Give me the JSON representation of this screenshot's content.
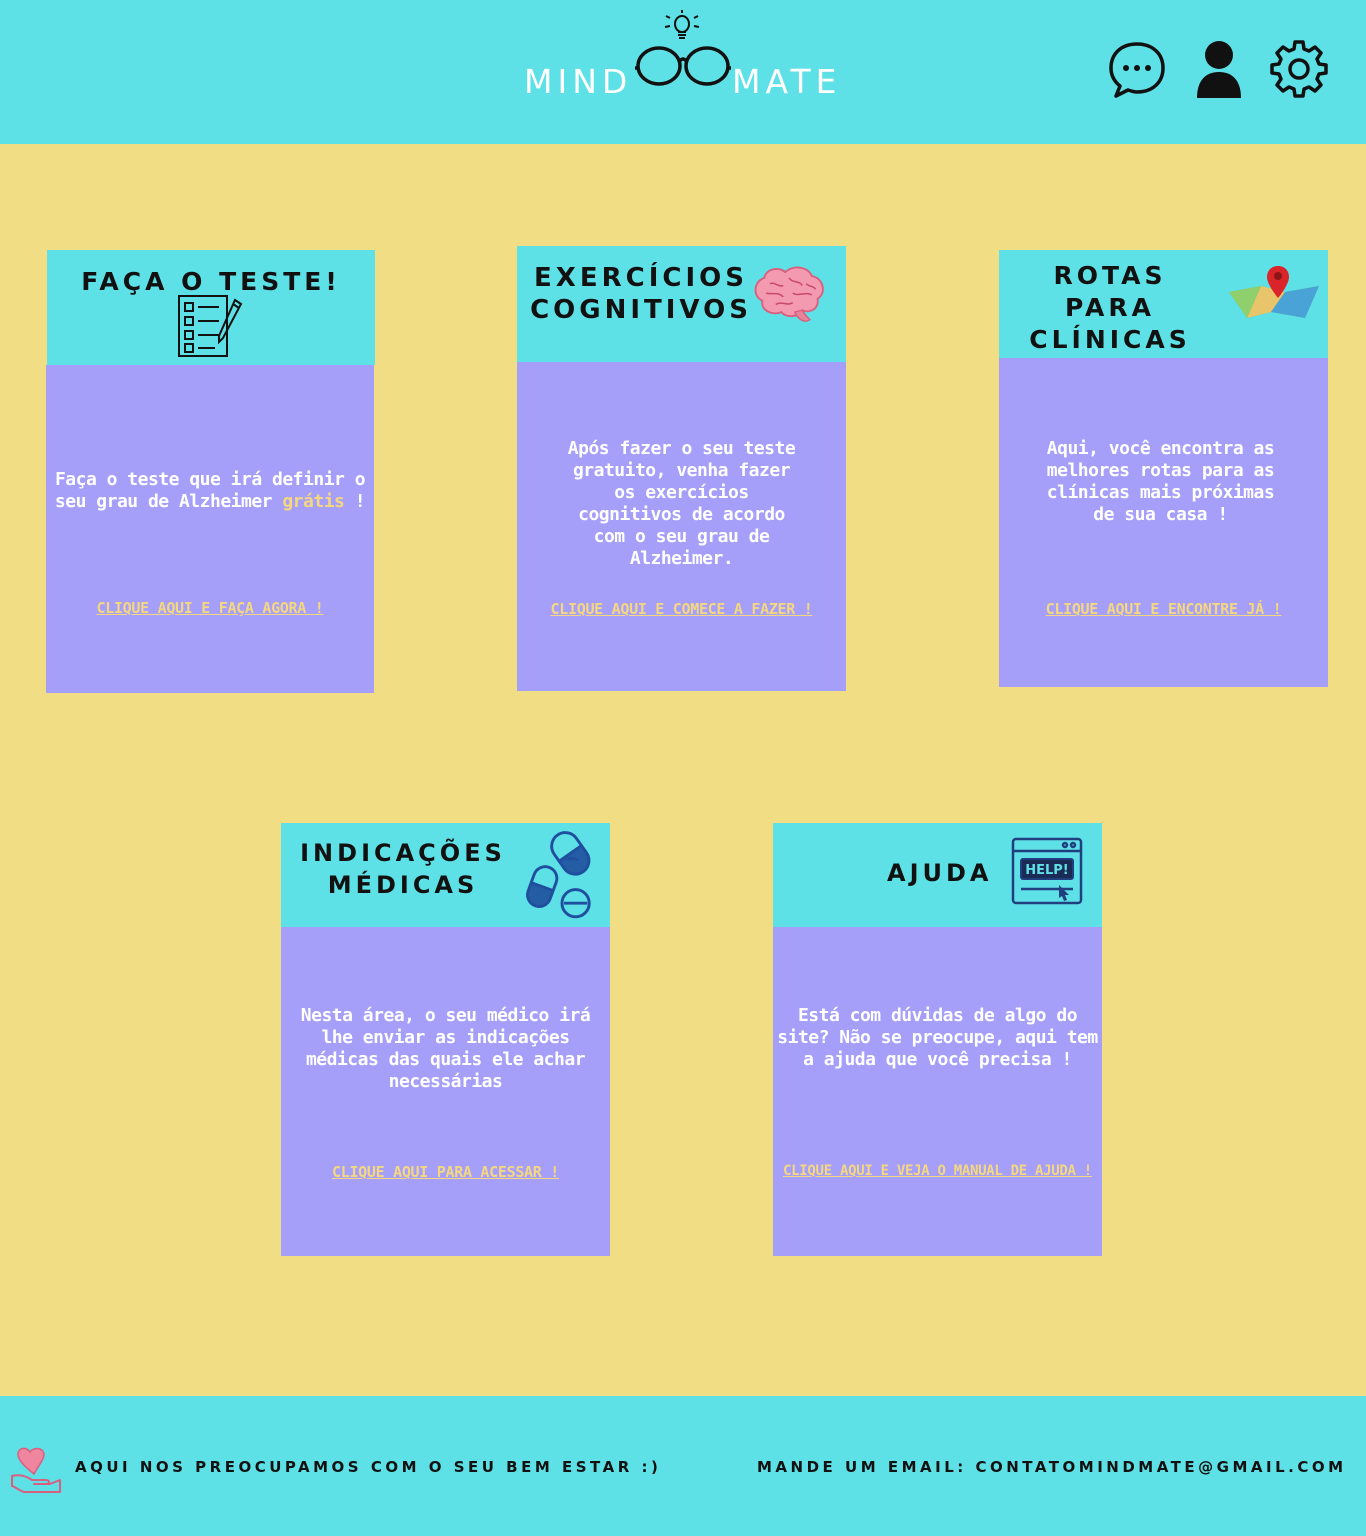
{
  "brand": {
    "left": "MIND",
    "right": "MATE"
  },
  "header": {
    "icons": [
      "chat-icon",
      "user-icon",
      "gear-icon"
    ]
  },
  "cards": {
    "teste": {
      "title": "FAÇA O TESTE!",
      "text_a": "Faça o teste que irá definir o seu grau de Alzheimer ",
      "text_highlight": "grátis",
      "text_b": " !",
      "link": "CLIQUE AQUI E FAÇA AGORA !",
      "icon": "checklist-icon"
    },
    "exercicios": {
      "title_line1": "EXERCÍCIOS",
      "title_line2": "COGNITIVOS",
      "text": "Após fazer o seu teste gratuito, venha fazer os exercícios cognitivos de acordo com o seu grau de Alzheimer.",
      "link": "CLIQUE AQUI E COMECE A FAZER !",
      "icon": "brain-icon"
    },
    "rotas": {
      "title_line1": "ROTAS PARA",
      "title_line2": "CLÍNICAS",
      "text": "Aqui, você encontra as melhores rotas para as clínicas mais próximas de sua casa !",
      "link": "CLIQUE AQUI E ENCONTRE JÁ !",
      "icon": "map-icon"
    },
    "indicacoes": {
      "title_line1": "INDICAÇÕES",
      "title_line2": "MÉDICAS",
      "text": "Nesta área, o seu médico irá lhe enviar as indicações médicas das quais ele achar necessárias",
      "link": "CLIQUE AQUI PARA ACESSAR !",
      "icon": "pills-icon"
    },
    "ajuda": {
      "title": "AJUDA",
      "text": "Está com dúvidas de algo do site? Não se preocupe, aqui tem a ajuda que você precisa !",
      "link": "CLIQUE AQUI E VEJA O MANUAL DE AJUDA !",
      "icon": "help-window-icon",
      "icon_text": "HELP!"
    }
  },
  "footer": {
    "left_text": "AQUI NOS PREOCUPAMOS COM O SEU BEM ESTAR :)",
    "right_text": "MANDE UM EMAIL: CONTATOMINDMATE@GMAIL.COM",
    "icon": "heart-hand-icon"
  },
  "colors": {
    "header": "#5ee1e6",
    "page": "#f1dd83",
    "card_body": "#a59ffa",
    "link": "#f4d77f"
  }
}
